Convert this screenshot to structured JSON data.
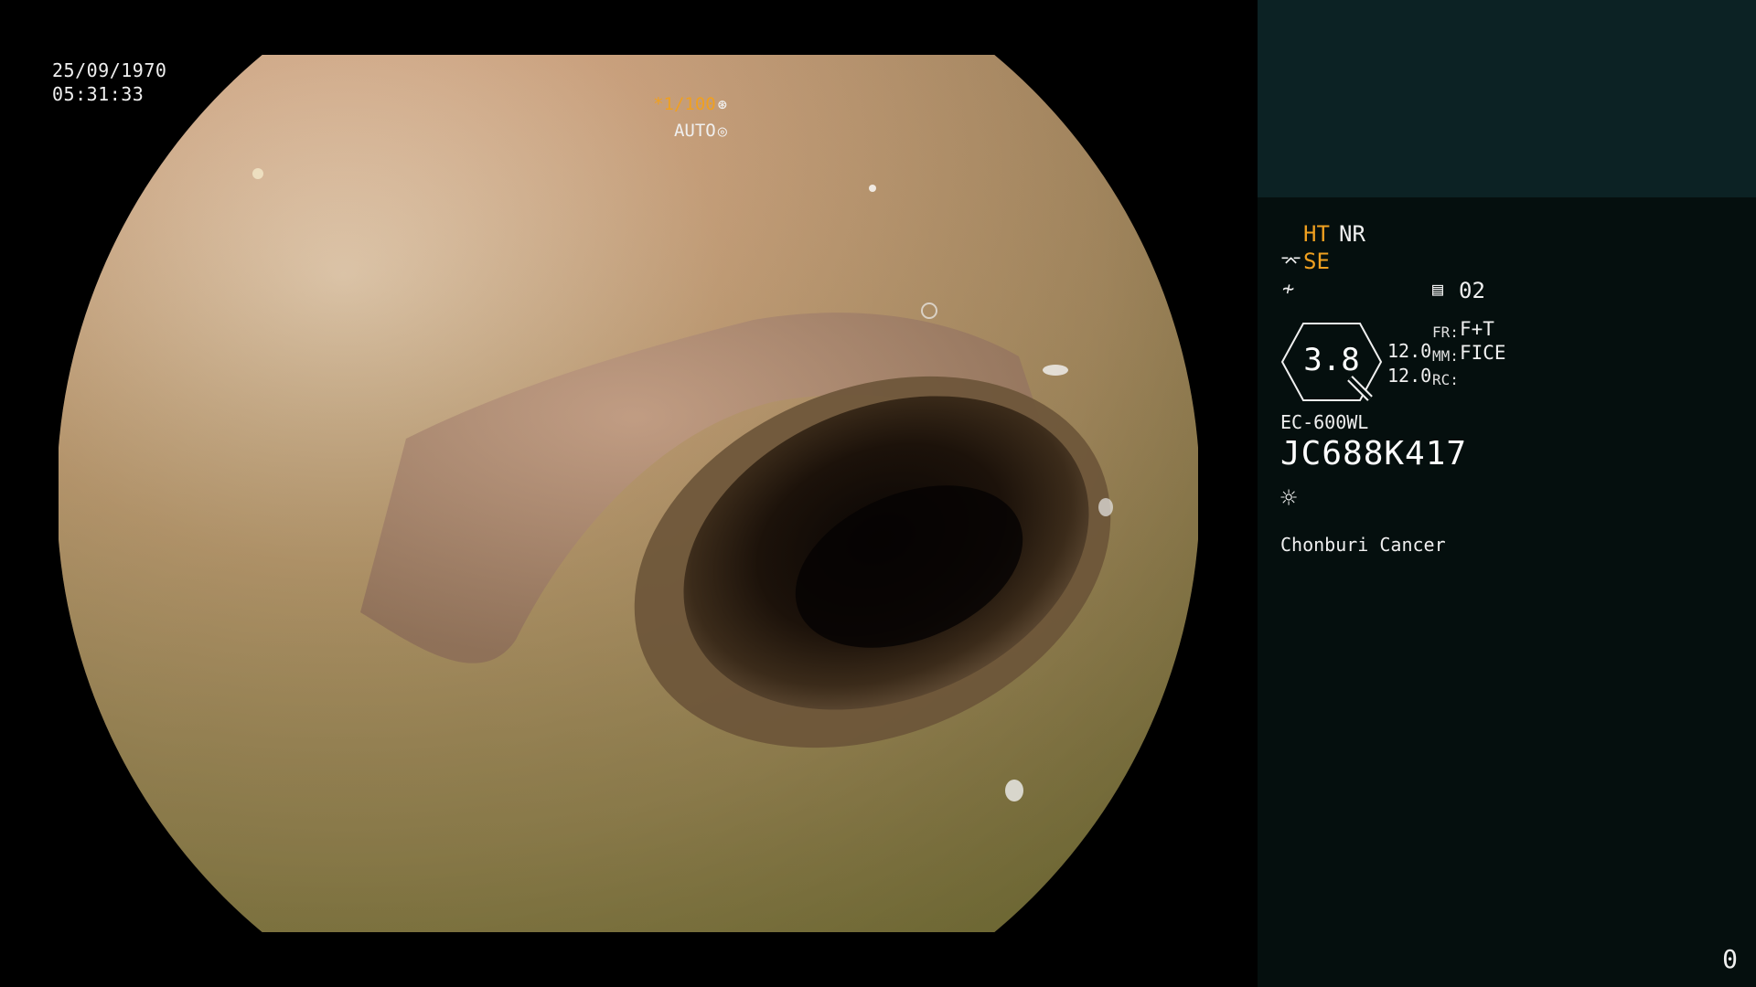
{
  "image": {
    "date": "25/09/1970",
    "time": "05:31:33",
    "shutter_speed": "*1/100",
    "shutter_mode": "AUTO",
    "shutter_speed_icon": "shutter-icon",
    "shutter_mode_icon": "iris-icon"
  },
  "settings": {
    "ht": "HT",
    "nr": "NR",
    "se": "SE",
    "se_icon": "scope-icon",
    "bypass_icon": "bypass-icon",
    "memory_icon": "memory-icon",
    "memory_value": "02",
    "zoom_value": "3.8",
    "level_1": "12.0",
    "level_2": "12.0",
    "fr_label": "FR:",
    "fr_value": "F+T",
    "mm_label": "MM:",
    "mm_value": "FICE",
    "rc_label": "RC:",
    "rc_value": "",
    "scope_model": "EC-600WL",
    "scope_serial": "JC688K417",
    "light_icon": "light-icon",
    "institution": "Chonburi Cancer"
  },
  "frame_counter": "0",
  "colors": {
    "accent": "#f0a020",
    "panel": "#050f0e",
    "panel_top": "#0c2224"
  }
}
